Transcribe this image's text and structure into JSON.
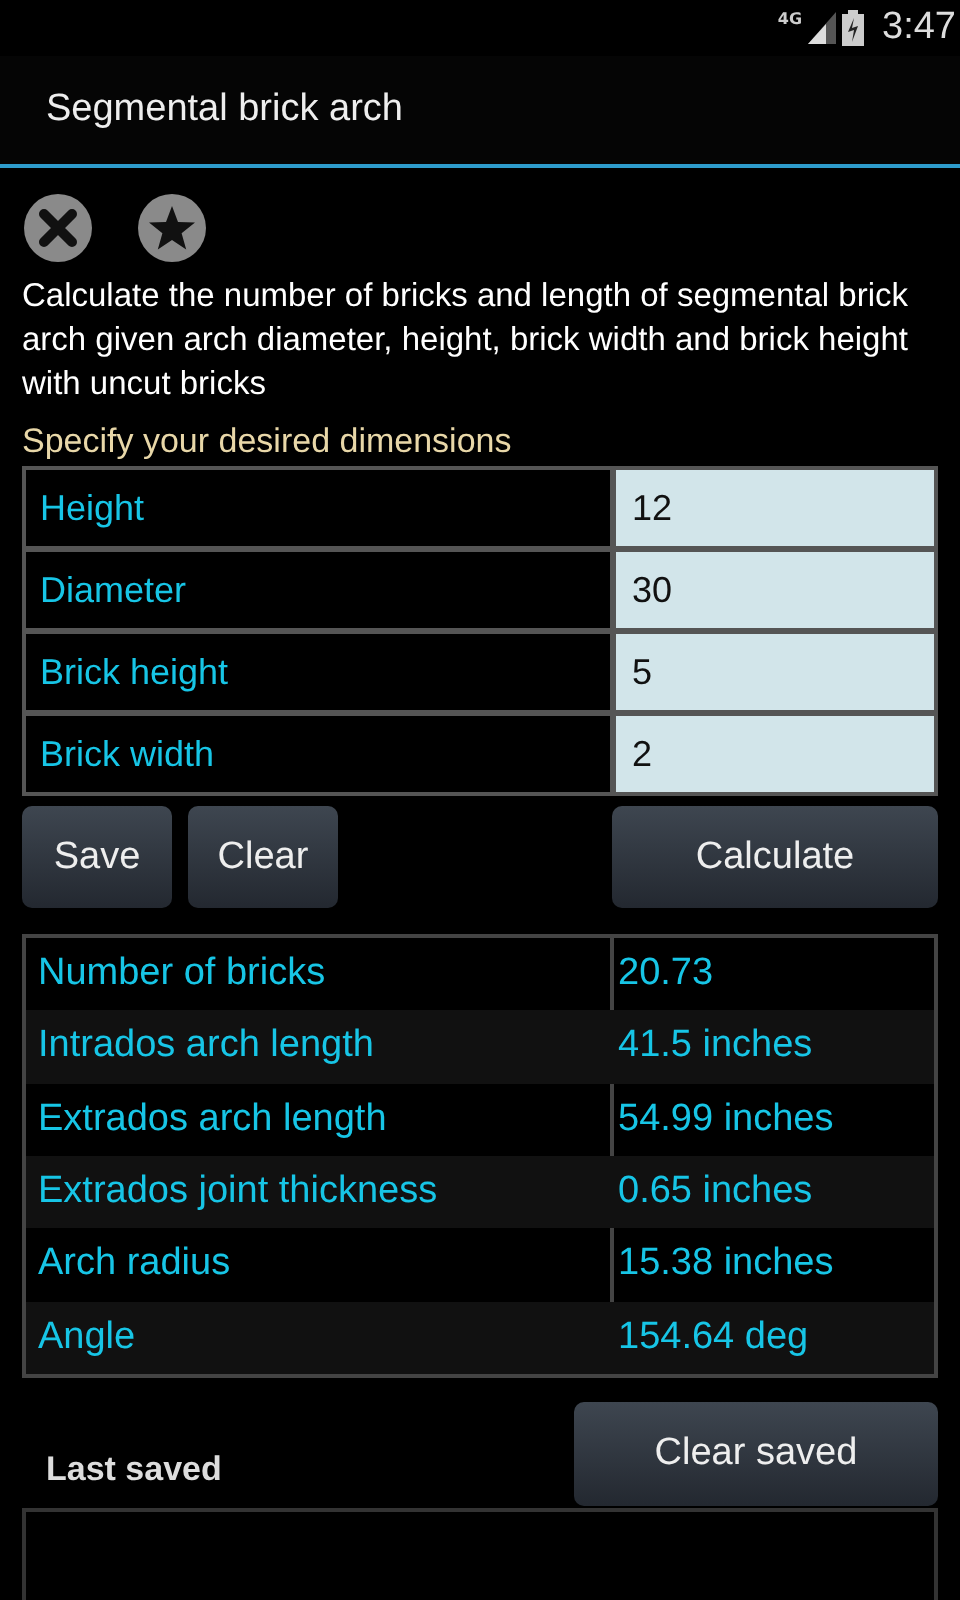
{
  "status_bar": {
    "network": "4G",
    "time": "3:47"
  },
  "action_bar": {
    "title": "Segmental brick arch"
  },
  "description": "Calculate the number of bricks and length of segmental brick arch given arch diameter, height, brick width and brick height with uncut bricks",
  "inputs_heading": "Specify your desired dimensions",
  "inputs": [
    {
      "label": "Height",
      "value": "12"
    },
    {
      "label": "Diameter",
      "value": "30"
    },
    {
      "label": "Brick height",
      "value": "5"
    },
    {
      "label": "Brick width",
      "value": "2"
    }
  ],
  "buttons": [
    "Save",
    "Clear",
    "Calculate"
  ],
  "results": [
    {
      "label": "Number of bricks",
      "value": "20.73"
    },
    {
      "label": "Intrados arch length",
      "value": "41.5 inches"
    },
    {
      "label": "Extrados arch length",
      "value": "54.99 inches"
    },
    {
      "label": "Extrados joint thickness",
      "value": "0.65 inches"
    },
    {
      "label": "Arch radius",
      "value": "15.38 inches"
    },
    {
      "label": "Angle",
      "value": "154.64 deg"
    }
  ],
  "saved": {
    "heading": "Last saved",
    "clear_button": "Clear saved"
  }
}
